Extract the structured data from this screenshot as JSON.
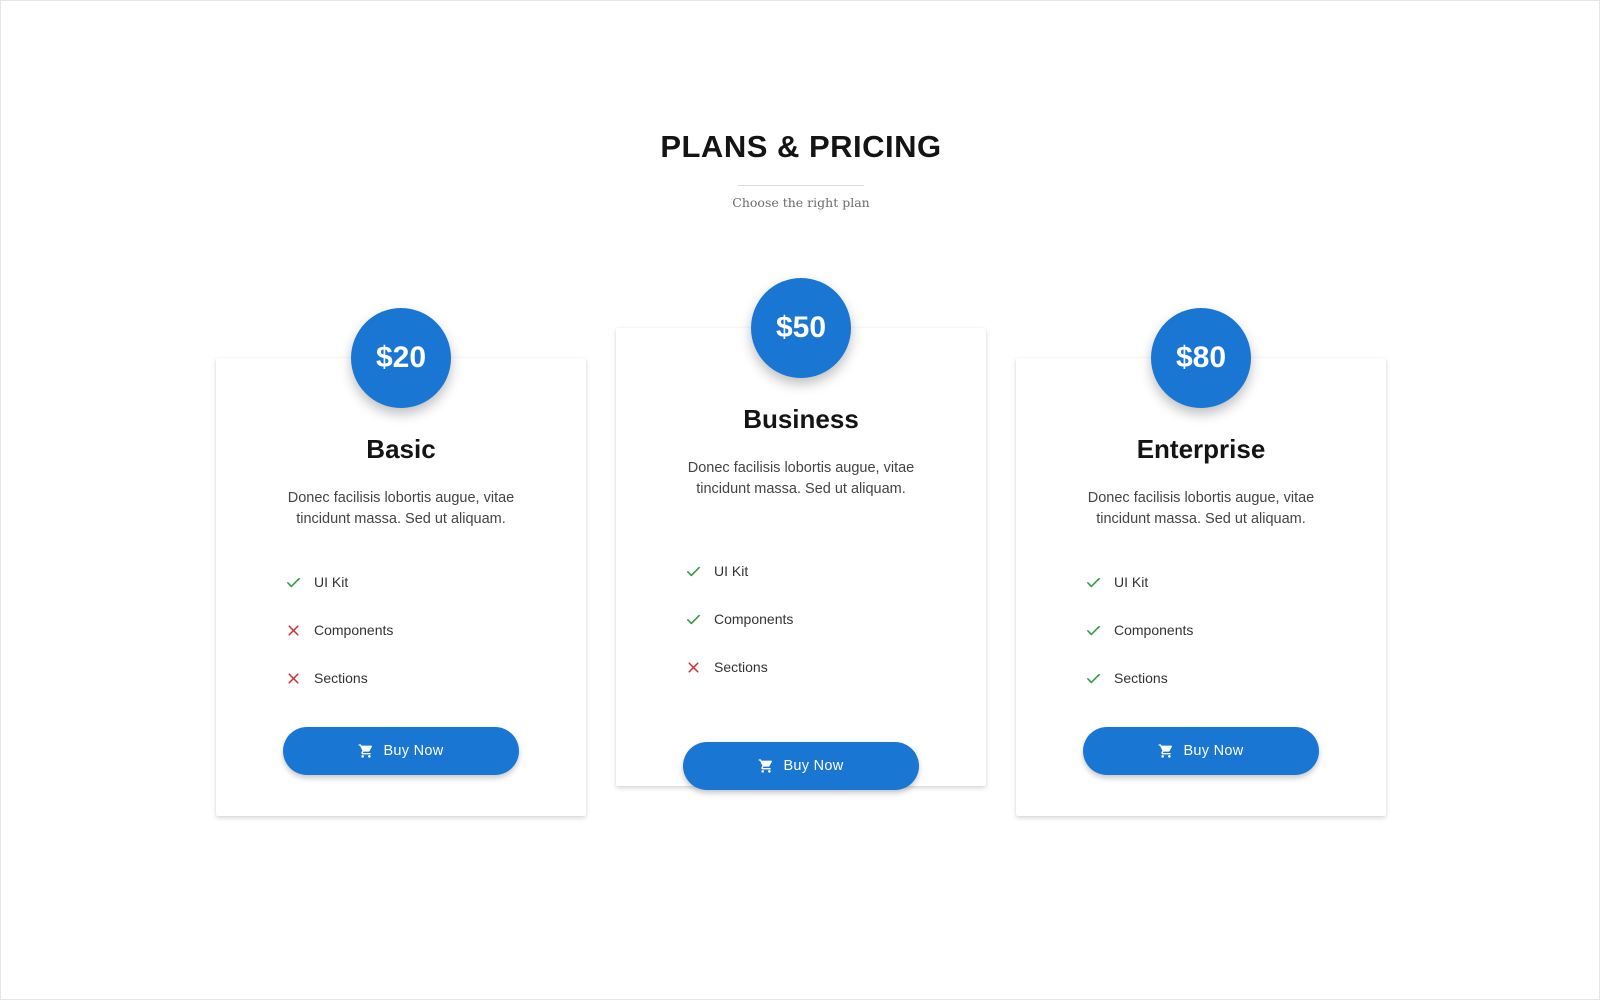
{
  "header": {
    "title": "PLANS & PRICING",
    "subtitle": "Choose the right plan"
  },
  "colors": {
    "accent": "#1976d2",
    "included": "#2e9e3e",
    "excluded": "#d32f2f"
  },
  "plans": [
    {
      "price": "$20",
      "name": "Basic",
      "description": "Donec facilisis lobortis augue, vitae tincidunt massa. Sed ut aliquam.",
      "features": [
        {
          "label": "UI Kit",
          "included": true,
          "icon": "check-icon"
        },
        {
          "label": "Components",
          "included": false,
          "icon": "cross-icon"
        },
        {
          "label": "Sections",
          "included": false,
          "icon": "cross-icon"
        }
      ],
      "button_label": "Buy Now"
    },
    {
      "price": "$50",
      "name": "Business",
      "description": "Donec facilisis lobortis augue, vitae tincidunt massa. Sed ut aliquam.",
      "features": [
        {
          "label": "UI Kit",
          "included": true,
          "icon": "check-icon"
        },
        {
          "label": "Components",
          "included": true,
          "icon": "check-icon"
        },
        {
          "label": "Sections",
          "included": false,
          "icon": "cross-icon"
        }
      ],
      "button_label": "Buy Now"
    },
    {
      "price": "$80",
      "name": "Enterprise",
      "description": "Donec facilisis lobortis augue, vitae tincidunt massa. Sed ut aliquam.",
      "features": [
        {
          "label": "UI Kit",
          "included": true,
          "icon": "check-icon"
        },
        {
          "label": "Components",
          "included": true,
          "icon": "check-icon"
        },
        {
          "label": "Sections",
          "included": true,
          "icon": "check-icon"
        }
      ],
      "button_label": "Buy Now"
    }
  ]
}
